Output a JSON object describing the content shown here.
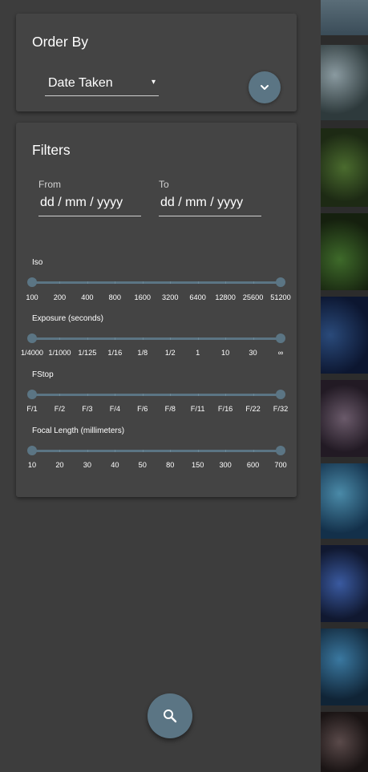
{
  "order_by": {
    "title": "Order By",
    "selected": "Date Taken",
    "dropdown_arrow": "▾",
    "expand_icon": "chevron-down-icon"
  },
  "filters": {
    "title": "Filters",
    "from_label": "From",
    "to_label": "To",
    "from_value": "dd / mm / yyyy",
    "to_value": "dd / mm / yyyy",
    "sliders": [
      {
        "label": "Iso",
        "ticks": [
          "100",
          "200",
          "400",
          "800",
          "1600",
          "3200",
          "6400",
          "12800",
          "25600",
          "51200"
        ],
        "low": 0,
        "high": 1
      },
      {
        "label": "Exposure (seconds)",
        "ticks": [
          "1/4000",
          "1/1000",
          "1/125",
          "1/16",
          "1/8",
          "1/2",
          "1",
          "10",
          "30",
          "∞"
        ],
        "low": 0,
        "high": 1
      },
      {
        "label": "FStop",
        "ticks": [
          "F/1",
          "F/2",
          "F/3",
          "F/4",
          "F/6",
          "F/8",
          "F/11",
          "F/16",
          "F/22",
          "F/32"
        ],
        "low": 0,
        "high": 1
      },
      {
        "label": "Focal Length (millimeters)",
        "ticks": [
          "10",
          "20",
          "30",
          "40",
          "50",
          "80",
          "150",
          "300",
          "600",
          "700"
        ],
        "low": 0,
        "high": 1
      }
    ]
  },
  "search_button": {
    "icon": "search-icon"
  },
  "colors": {
    "accent": "#5b7584",
    "card": "#444444",
    "background": "#3d3d3d"
  }
}
